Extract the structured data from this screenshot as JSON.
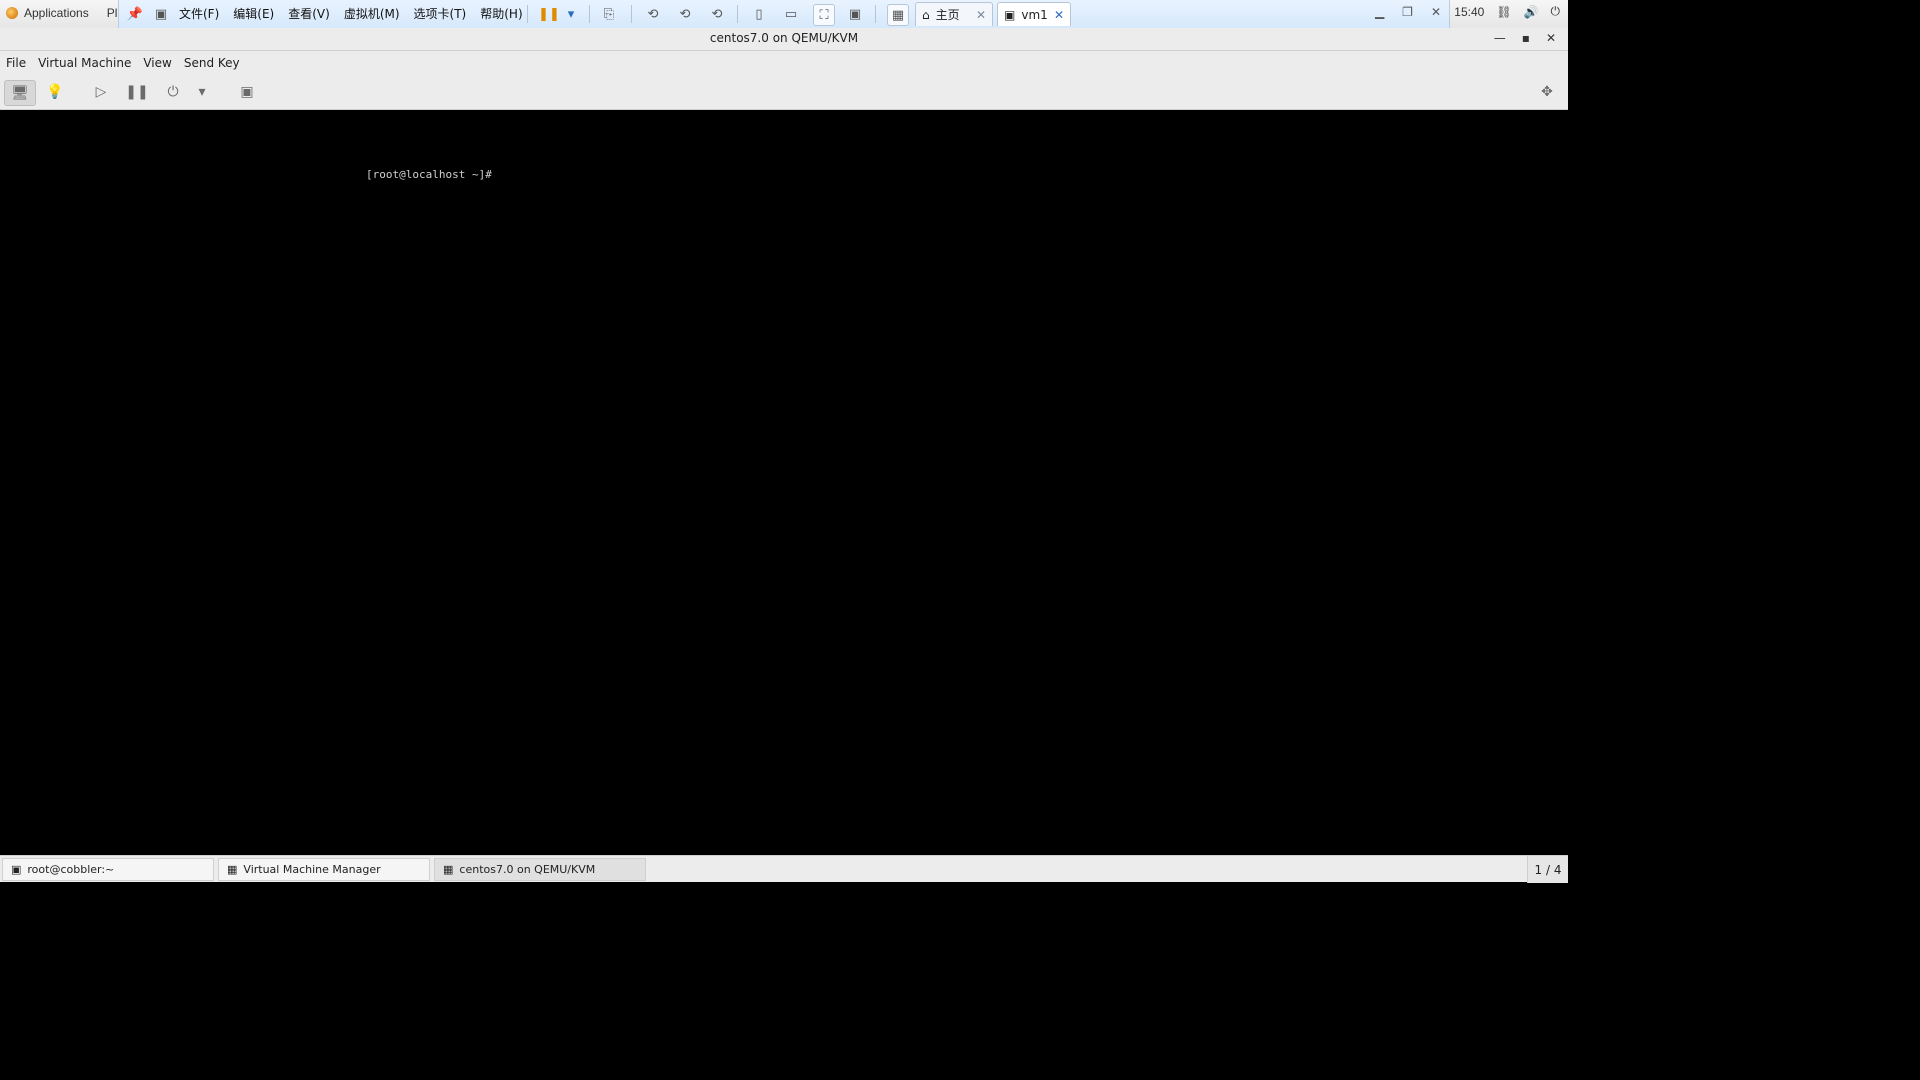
{
  "top": {
    "applications_label": "Applications",
    "places_partial": "Pl",
    "time": "15:40"
  },
  "vmware": {
    "menu": [
      "文件(F)",
      "编辑(E)",
      "查看(V)",
      "虚拟机(M)",
      "选项卡(T)",
      "帮助(H)"
    ],
    "tabs": [
      {
        "label": "主页"
      },
      {
        "label": "vm1"
      }
    ]
  },
  "window": {
    "title": "centos7.0 on QEMU/KVM"
  },
  "menubar": [
    "File",
    "Virtual Machine",
    "View",
    "Send Key"
  ],
  "console": {
    "prompt": "[root@localhost ~]#"
  },
  "taskbar": {
    "items": [
      {
        "label": "root@cobbler:~"
      },
      {
        "label": "Virtual Machine Manager"
      },
      {
        "label": "centos7.0 on QEMU/KVM"
      }
    ],
    "workspace": "1 / 4"
  },
  "icons": {
    "apps": "apps-icon",
    "network": "network-icon",
    "volume": "volume-icon",
    "power": "power-icon"
  }
}
